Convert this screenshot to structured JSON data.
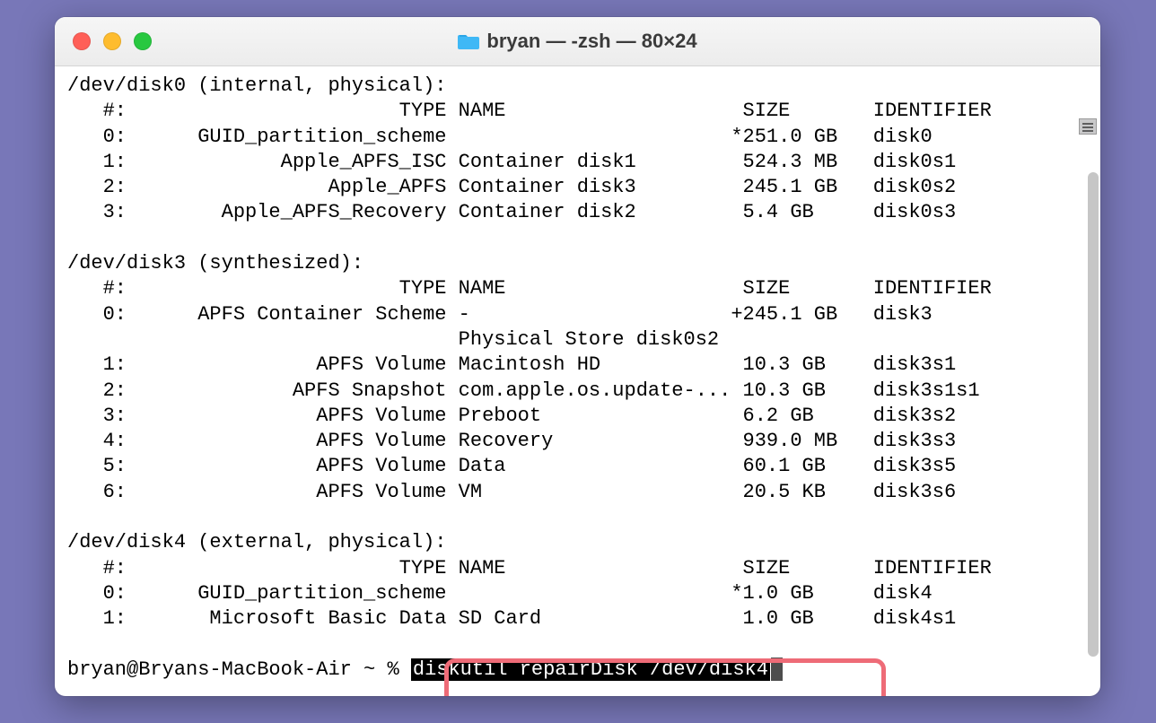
{
  "window": {
    "title": "bryan — -zsh — 80×24"
  },
  "disks": [
    {
      "header": "/dev/disk0 (internal, physical):",
      "columns": "   #:                       TYPE NAME                    SIZE       IDENTIFIER",
      "rows": [
        "   0:      GUID_partition_scheme                        *251.0 GB   disk0",
        "   1:             Apple_APFS_ISC Container disk1         524.3 MB   disk0s1",
        "   2:                 Apple_APFS Container disk3         245.1 GB   disk0s2",
        "   3:        Apple_APFS_Recovery Container disk2         5.4 GB     disk0s3"
      ]
    },
    {
      "header": "/dev/disk3 (synthesized):",
      "columns": "   #:                       TYPE NAME                    SIZE       IDENTIFIER",
      "rows": [
        "   0:      APFS Container Scheme -                      +245.1 GB   disk3",
        "                                 Physical Store disk0s2",
        "   1:                APFS Volume Macintosh HD            10.3 GB    disk3s1",
        "   2:              APFS Snapshot com.apple.os.update-... 10.3 GB    disk3s1s1",
        "   3:                APFS Volume Preboot                 6.2 GB     disk3s2",
        "   4:                APFS Volume Recovery                939.0 MB   disk3s3",
        "   5:                APFS Volume Data                    60.1 GB    disk3s5",
        "   6:                APFS Volume VM                      20.5 KB    disk3s6"
      ]
    },
    {
      "header": "/dev/disk4 (external, physical):",
      "columns": "   #:                       TYPE NAME                    SIZE       IDENTIFIER",
      "rows": [
        "   0:      GUID_partition_scheme                        *1.0 GB     disk4",
        "   1:       Microsoft Basic Data SD Card                 1.0 GB     disk4s1"
      ]
    }
  ],
  "prompt": {
    "prefix": "bryan@Bryans-MacBook-Air ~ % ",
    "command": "diskutil repairDisk /dev/disk4"
  }
}
